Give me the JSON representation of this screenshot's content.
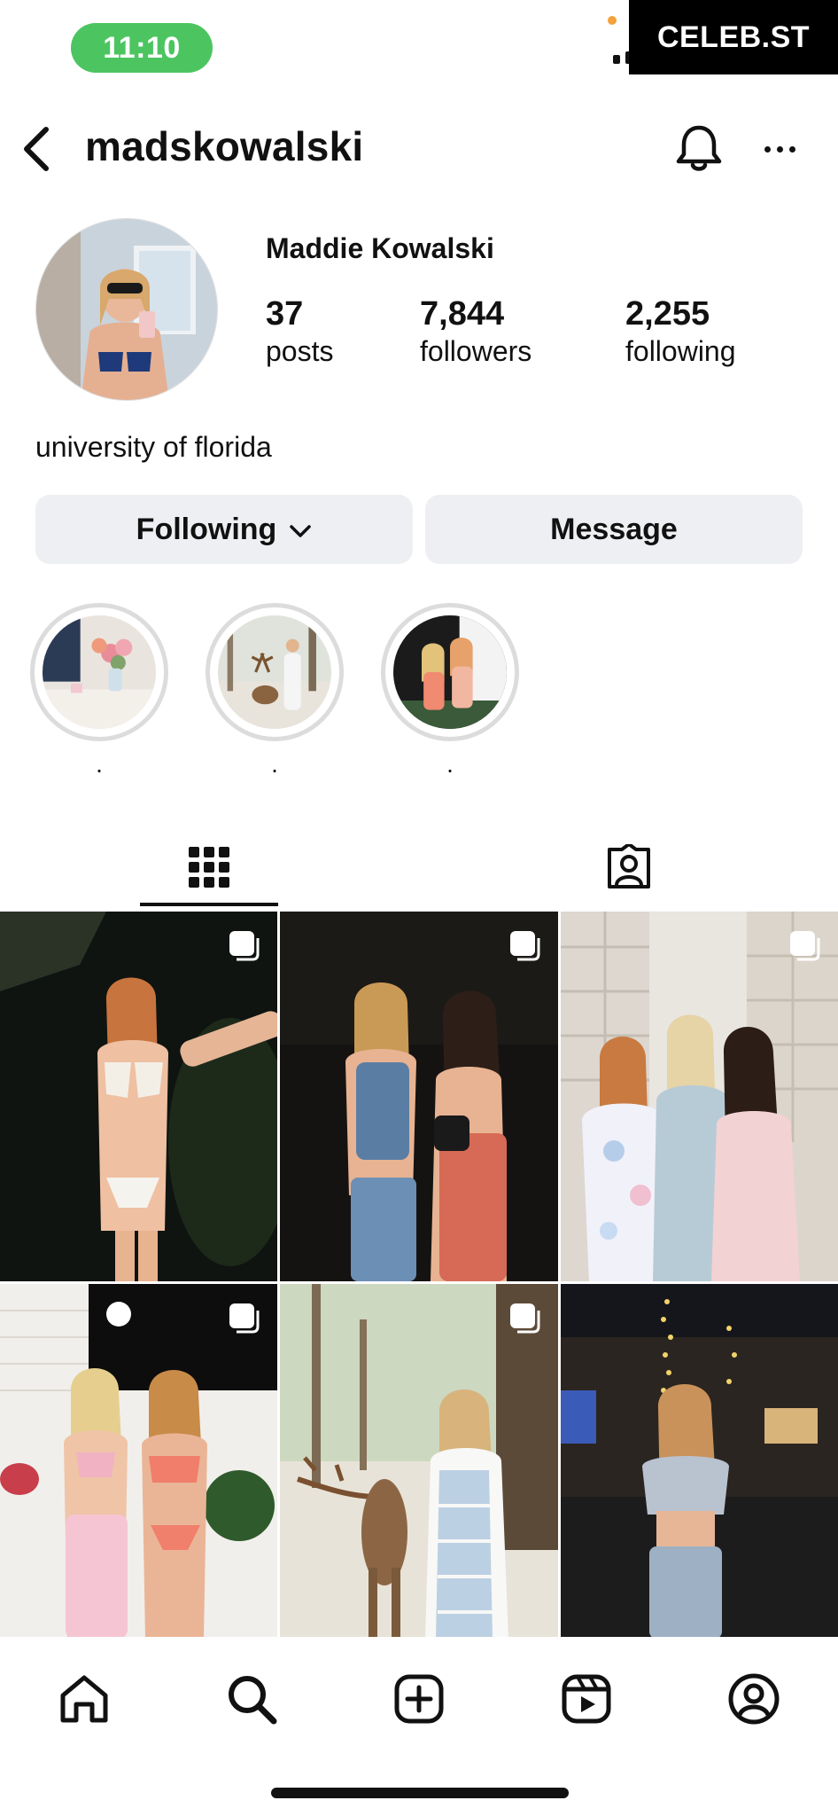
{
  "status_bar": {
    "time": "11:10",
    "watermark": "CELEB.ST"
  },
  "header": {
    "username": "madskowalski"
  },
  "profile": {
    "display_name": "Maddie Kowalski",
    "stats": [
      {
        "value": "37",
        "label": "posts"
      },
      {
        "value": "7,844",
        "label": "followers"
      },
      {
        "value": "2,255",
        "label": "following"
      }
    ],
    "bio": "university of florida"
  },
  "buttons": {
    "following_label": "Following",
    "message_label": "Message"
  },
  "highlights": [
    {
      "label": "."
    },
    {
      "label": "."
    },
    {
      "label": "."
    }
  ],
  "tabs": {
    "grid_icon": "grid-icon",
    "tagged_icon": "tagged-icon"
  },
  "nav": {
    "icons": [
      "home-icon",
      "search-icon",
      "create-icon",
      "reels-icon",
      "profile-icon"
    ]
  },
  "colors": {
    "time_pill": "#4cc560",
    "button_bg": "#eeeff2",
    "text": "#111111"
  }
}
